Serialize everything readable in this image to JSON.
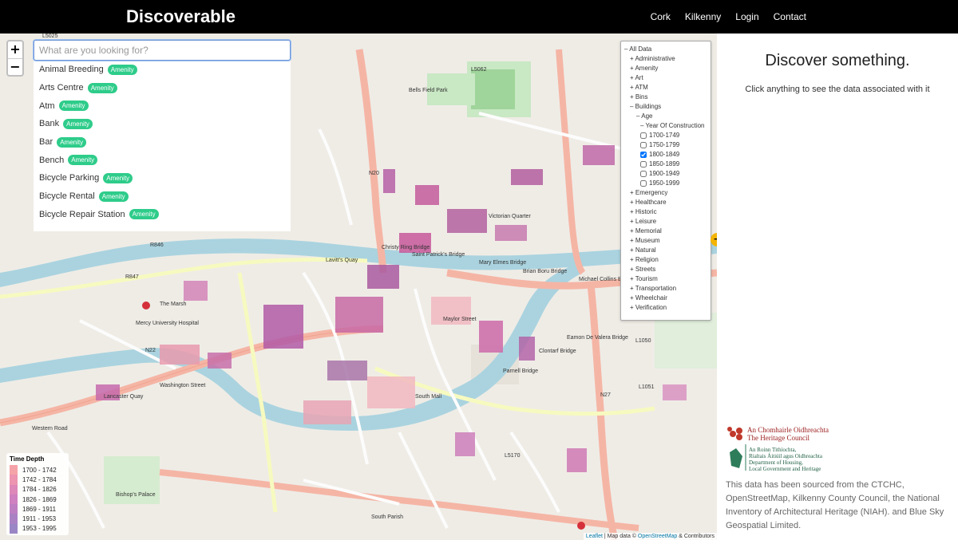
{
  "app": {
    "brand": "Discoverable",
    "nav": [
      "Cork",
      "Kilkenny",
      "Login",
      "Contact"
    ]
  },
  "map": {
    "zoom_in": "+",
    "zoom_out": "−",
    "search_placeholder": "What are you looking for?",
    "results": [
      {
        "label": "Animal Breeding",
        "badge": "Amenity"
      },
      {
        "label": "Arts Centre",
        "badge": "Amenity"
      },
      {
        "label": "Atm",
        "badge": "Amenity"
      },
      {
        "label": "Bank",
        "badge": "Amenity"
      },
      {
        "label": "Bar",
        "badge": "Amenity"
      },
      {
        "label": "Bench",
        "badge": "Amenity"
      },
      {
        "label": "Bicycle Parking",
        "badge": "Amenity"
      },
      {
        "label": "Bicycle Rental",
        "badge": "Amenity"
      },
      {
        "label": "Bicycle Repair Station",
        "badge": "Amenity"
      }
    ],
    "tree": [
      {
        "text": "– All Data",
        "indent": 0
      },
      {
        "text": "+ Administrative",
        "indent": 1
      },
      {
        "text": "+ Amenity",
        "indent": 1
      },
      {
        "text": "+ Art",
        "indent": 1
      },
      {
        "text": "+ ATM",
        "indent": 1
      },
      {
        "text": "+ Bins",
        "indent": 1
      },
      {
        "text": "– Buildings",
        "indent": 1
      },
      {
        "text": "– Age",
        "indent": 2
      },
      {
        "text": "– Year Of Construction",
        "indent": 3
      },
      {
        "text": "1700-1749",
        "indent": 3,
        "checkbox": true,
        "checked": false
      },
      {
        "text": "1750-1799",
        "indent": 3,
        "checkbox": true,
        "checked": false
      },
      {
        "text": "1800-1849",
        "indent": 3,
        "checkbox": true,
        "checked": true
      },
      {
        "text": "1850-1899",
        "indent": 3,
        "checkbox": true,
        "checked": false
      },
      {
        "text": "1900-1949",
        "indent": 3,
        "checkbox": true,
        "checked": false
      },
      {
        "text": "1950-1999",
        "indent": 3,
        "checkbox": true,
        "checked": false
      },
      {
        "text": "+ Emergency",
        "indent": 1
      },
      {
        "text": "+ Healthcare",
        "indent": 1
      },
      {
        "text": "+ Historic",
        "indent": 1
      },
      {
        "text": "+ Leisure",
        "indent": 1
      },
      {
        "text": "+ Memorial",
        "indent": 1
      },
      {
        "text": "+ Museum",
        "indent": 1
      },
      {
        "text": "+ Natural",
        "indent": 1
      },
      {
        "text": "+ Religion",
        "indent": 1
      },
      {
        "text": "+ Streets",
        "indent": 1
      },
      {
        "text": "+ Tourism",
        "indent": 1
      },
      {
        "text": "+ Transportation",
        "indent": 1
      },
      {
        "text": "+ Wheelchair",
        "indent": 1
      },
      {
        "text": "+ Verification",
        "indent": 1
      }
    ],
    "legend": {
      "title": "Time Depth",
      "items": [
        {
          "label": "1700 - 1742",
          "color": "#f5a3a8"
        },
        {
          "label": "1742 - 1784",
          "color": "#ec94b0"
        },
        {
          "label": "1784 - 1826",
          "color": "#dd88b8"
        },
        {
          "label": "1826 - 1869",
          "color": "#ce80c0"
        },
        {
          "label": "1869 - 1911",
          "color": "#bd7fc2"
        },
        {
          "label": "1911 - 1953",
          "color": "#aa82c4"
        },
        {
          "label": "1953 - 1995",
          "color": "#9a86c5"
        }
      ]
    },
    "attribution": {
      "leaflet": "Leaflet",
      "text": " | Map data © ",
      "osm": "OpenStreetMap",
      "suffix": " & Contributors"
    },
    "labels": [
      "Christy Ring Bridge",
      "Saint Patrick's Bridge",
      "Mary Elmes Bridge",
      "Brian Boru Bridge",
      "Michael Collins Bridge",
      "Clontarf Bridge",
      "Eamon De Valera Bridge",
      "Parnell Bridge",
      "Mercy University Hospital",
      "The Marsh",
      "Bishop's Palace",
      "South Parish",
      "Victorian Quarter",
      "Bells Field Park",
      "Lancaster Quay",
      "Western Road",
      "Washington Street",
      "South Mall",
      "Lavitt's Quay",
      "Maylor Street",
      "N20",
      "N22",
      "N27",
      "R846",
      "R847",
      "L5062",
      "L5170",
      "L1050",
      "L1051",
      "L5025"
    ]
  },
  "sidebar": {
    "title": "Discover something.",
    "subtitle": "Click anything to see the data associated with it",
    "logo_heritage_ga": "An Chomhairle Oidhreachta",
    "logo_heritage_en": "The Heritage Council",
    "logo_dept_ga1": "An Roinn Tithíochta,",
    "logo_dept_ga2": "Rialtais Áitiúil agus Oidhreachta",
    "logo_dept_en1": "Department of Housing,",
    "logo_dept_en2": "Local Government and Heritage",
    "credits": "This data has been sourced from the CTCHC, OpenStreetMap, Kilkenny County Council, the National Inventory of Architectural Heritage (NIAH). and Blue Sky Geospatial Limited."
  }
}
